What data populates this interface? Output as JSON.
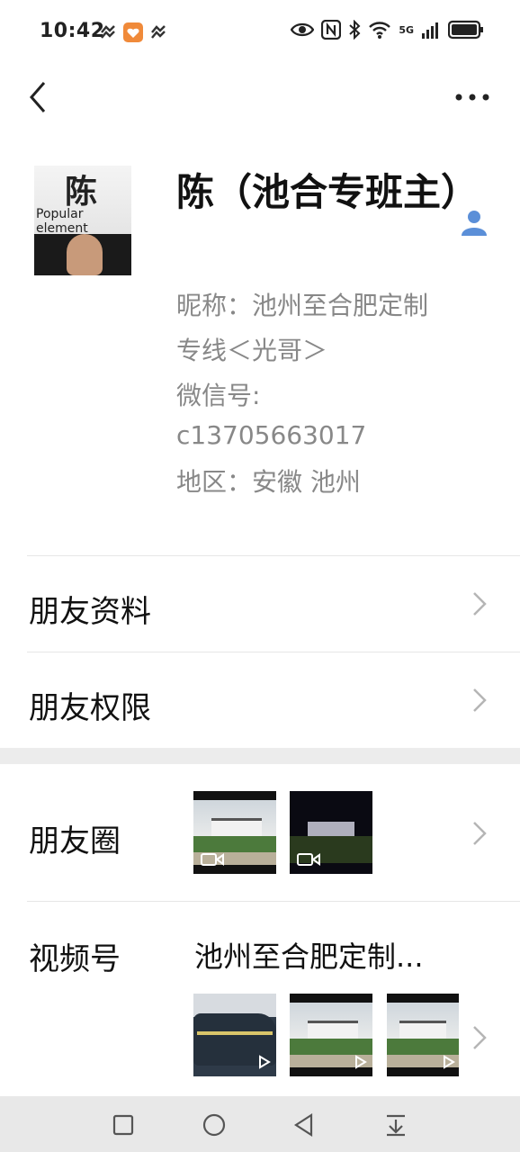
{
  "status_bar": {
    "time": "10:42",
    "network_label": "5G"
  },
  "nav": {
    "back_icon": "chevron-left-icon",
    "more_icon": "more-dots-icon"
  },
  "profile": {
    "name": "陈（池合专班主）",
    "nickname": "昵称：池州至合肥定制专线＜光哥＞",
    "nickname_line1": "昵称：池州至合肥定制",
    "nickname_line2": "专线＜光哥＞",
    "wechat_id_label": "微信号:",
    "wechat_id": "c13705663017",
    "region": "地区：安徽  池州",
    "avatar_text_1": "Popular",
    "avatar_text_2": "element",
    "avatar_char": "陈"
  },
  "rows": {
    "friend_profile": "朋友资料",
    "friend_permissions": "朋友权限",
    "moments": "朋友圈",
    "channels": "视频号",
    "channel_name": "池州至合肥定制..."
  },
  "colors": {
    "accent_blue": "#5b8fd8",
    "gray_text": "#888888",
    "band": "#ececec"
  }
}
